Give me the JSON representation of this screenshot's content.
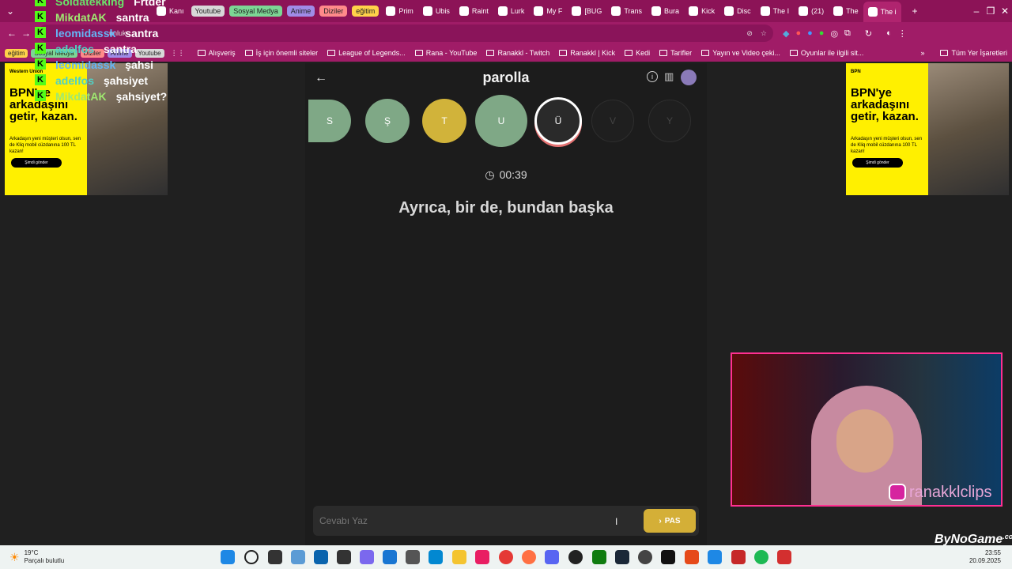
{
  "browser": {
    "tabs": [
      {
        "label": "Kanı"
      },
      {
        "label": "Youtube",
        "group": true,
        "color": "#d8d8d8"
      },
      {
        "label": "Sosyal Medya",
        "group": true,
        "color": "#7cd694"
      },
      {
        "label": "Anime",
        "group": true,
        "color": "#a08ce8"
      },
      {
        "label": "Diziler",
        "group": true,
        "color": "#ff8a8a"
      },
      {
        "label": "eğitim",
        "group": true,
        "color": "#ffd24a"
      },
      {
        "label": "Prim"
      },
      {
        "label": "Ubis"
      },
      {
        "label": "Raint"
      },
      {
        "label": "Lurk"
      },
      {
        "label": "My F"
      },
      {
        "label": "[BUG"
      },
      {
        "label": "Trans"
      },
      {
        "label": "Bura"
      },
      {
        "label": "Kick"
      },
      {
        "label": "Disc"
      },
      {
        "label": "The I"
      },
      {
        "label": "(21)"
      },
      {
        "label": "The"
      },
      {
        "label": "The i"
      }
    ],
    "address_suffix": "unluk",
    "bookmarks": [
      "Alışveriş",
      "İş için önemli siteler",
      "League of Legends...",
      "Rana - YouTube",
      "Ranakkl - Twitch",
      "Ranakkl | Kick",
      "Kedi",
      "Tarifler",
      "Yayın ve Video çeki...",
      "Oyunlar ile ilgili sit..."
    ],
    "bookmark_groups": [
      "eğitim",
      "Sosyal Medya",
      "Diziler",
      "Anime",
      "Youtube"
    ],
    "all_bookmarks": "Tüm Yer İşaretleri"
  },
  "chat_overlay": [
    {
      "user": "Soldatekking",
      "msg": "Frtder",
      "color": "#6ae36a"
    },
    {
      "user": "MikdatAK",
      "msg": "santra",
      "color": "#9fe870"
    },
    {
      "user": "leomidassk",
      "msg": "santra",
      "color": "#64b5f6"
    },
    {
      "user": "adelfos",
      "msg": "santra",
      "color": "#4fd1c5"
    },
    {
      "user": "leomidassk",
      "msg": "şahsi",
      "color": "#64b5f6"
    },
    {
      "user": "adelfos",
      "msg": "şahsiyet",
      "color": "#4fd1c5"
    },
    {
      "user": "MikdatAK",
      "msg": "şahsiyet?",
      "color": "#9fe870"
    }
  ],
  "ads": {
    "brand_left": "Western Union",
    "brand_right": "BPN",
    "headline_left": "BPN'ye arkadaşını getir, kazan.",
    "headline_right": "BPN'ye arkadaşını getir, kazan.",
    "body": "Arkadaşın yeni müşteri olsun, sen de Kliq mobil cüzdanına 100 TL kazan!",
    "cta": "Şimdi gönder"
  },
  "game": {
    "title": "parolla",
    "letters": [
      {
        "letter": "S",
        "state": "correct",
        "color": "#7fa886"
      },
      {
        "letter": "Ş",
        "state": "correct",
        "color": "#7fa886"
      },
      {
        "letter": "T",
        "state": "passed",
        "color": "#d1b33a"
      },
      {
        "letter": "U",
        "state": "correct",
        "color": "#7fa886"
      },
      {
        "letter": "Ü",
        "state": "current",
        "color": "#2a2a2a"
      },
      {
        "letter": "V",
        "state": "pending",
        "color": "#1f1f1f"
      },
      {
        "letter": "Y",
        "state": "pending",
        "color": "#1f1f1f"
      }
    ],
    "timer": "00:39",
    "question": "Ayrıca, bir de, bundan başka",
    "input_placeholder": "Cevabı Yaz",
    "pass_label": "PAS"
  },
  "webcam": {
    "handle": "ranakklclips"
  },
  "watermark": "ByNoGame",
  "watermark_suffix": ".com",
  "taskbar": {
    "temp": "19°C",
    "weather": "Parçalı bulutlu",
    "time": "23:55",
    "date": "20.09.2025"
  }
}
